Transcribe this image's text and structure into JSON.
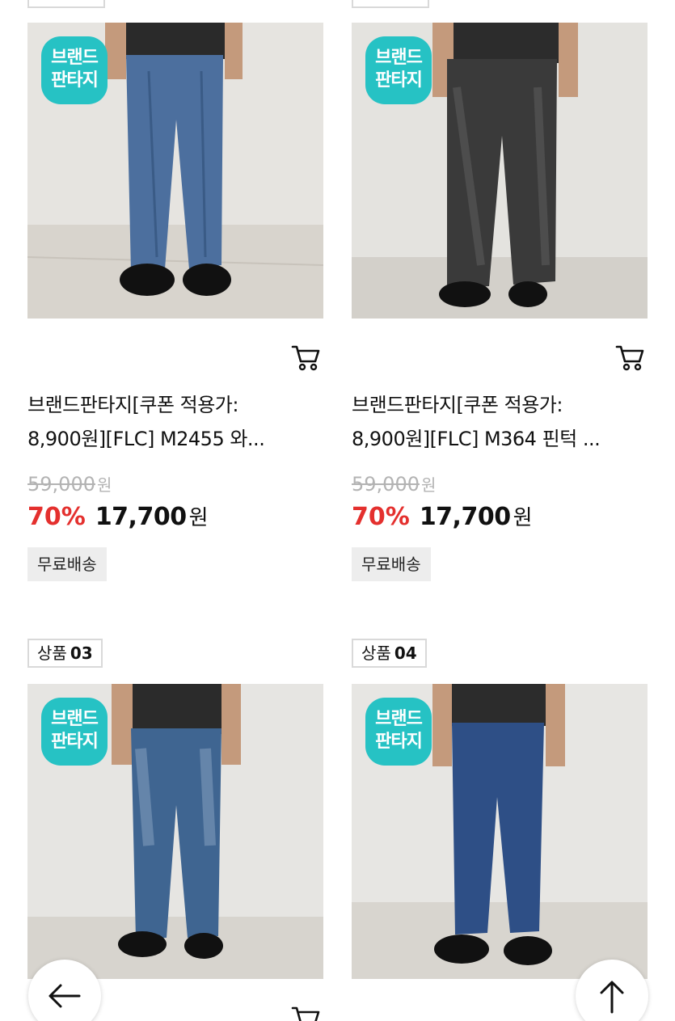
{
  "products": [
    {
      "tag_prefix": "",
      "tag_number": "",
      "brand_badge": [
        "브랜드",
        "판타지"
      ],
      "title_line1": "브랜드판타지[쿠폰 적용가:",
      "title_line2": "8,900원][FLC] M2455 와...",
      "original_price": "59,000",
      "original_unit": "원",
      "discount": "70%",
      "price": "17,700",
      "price_unit": "원",
      "shipping": "무료배송"
    },
    {
      "tag_prefix": "",
      "tag_number": "",
      "brand_badge": [
        "브랜드",
        "판타지"
      ],
      "title_line1": "브랜드판타지[쿠폰 적용가:",
      "title_line2": "8,900원][FLC] M364 핀턱 ...",
      "original_price": "59,000",
      "original_unit": "원",
      "discount": "70%",
      "price": "17,700",
      "price_unit": "원",
      "shipping": "무료배송"
    },
    {
      "tag_prefix": "상품",
      "tag_number": "03",
      "brand_badge": [
        "브랜드",
        "판타지"
      ]
    },
    {
      "tag_prefix": "상품",
      "tag_number": "04",
      "brand_badge": [
        "브랜드",
        "판타지"
      ]
    }
  ],
  "icons": {
    "cart": "cart-icon",
    "back": "arrow-left-icon",
    "top": "arrow-up-icon"
  },
  "colors": {
    "badge": "#26c2c4",
    "discount": "#e4302e",
    "strikethrough": "#b3b3b3",
    "shipping_bg": "#ededed"
  }
}
